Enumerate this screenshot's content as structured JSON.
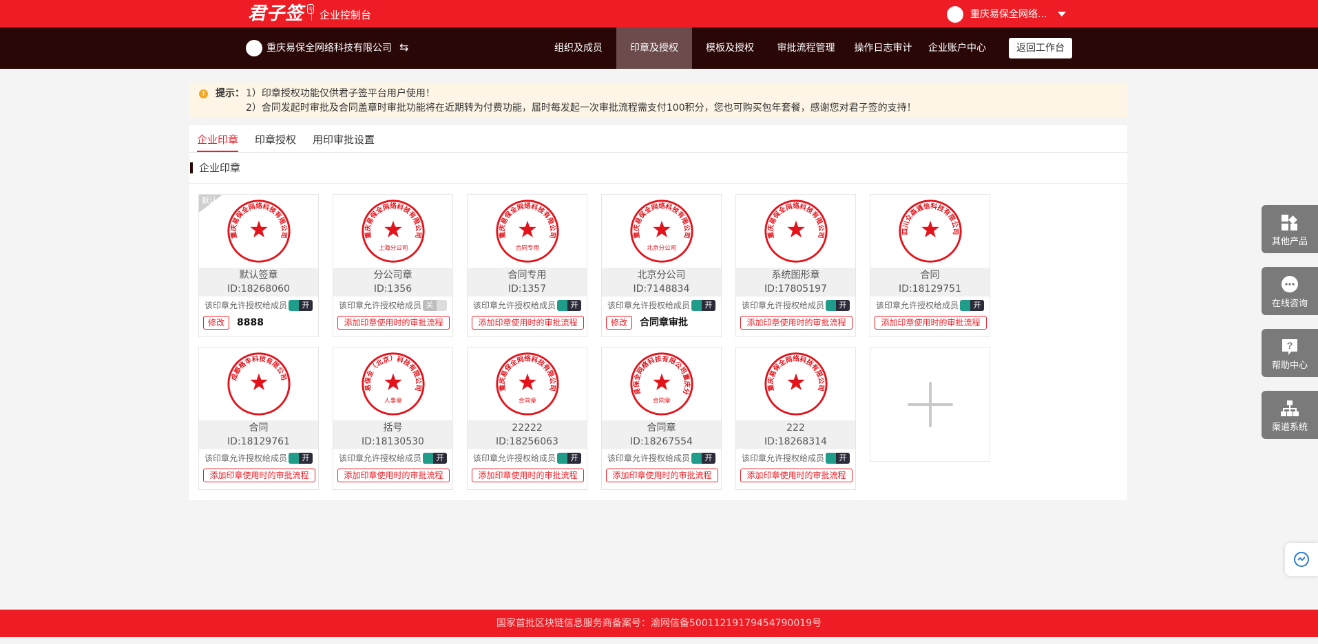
{
  "topbar": {
    "logo": "君子签",
    "logo_badge": "®",
    "console_title": "企业控制台",
    "user_name": "重庆易保全网络..."
  },
  "nav": {
    "company_name": "重庆易保全网络科技有限公司",
    "switch_icon": "⇆",
    "items": [
      {
        "label": "组织及成员",
        "active": false
      },
      {
        "label": "印章及授权",
        "active": true
      },
      {
        "label": "模板及授权",
        "active": false
      },
      {
        "label": "审批流程管理",
        "active": false
      },
      {
        "label": "操作日志审计",
        "active": false
      },
      {
        "label": "企业账户中心",
        "active": false
      }
    ],
    "back_label": "返回工作台"
  },
  "notice": {
    "icon": "!",
    "label": "提示：",
    "line1": "1）印章授权功能仅供君子签平台用户使用！",
    "line2": "2）合同发起时审批及合同盖章时审批功能将在近期转为付费功能，届时每发起一次审批流程需支付100积分，您也可购买包年套餐，感谢您对君子签的支持！"
  },
  "tabs": [
    {
      "label": "企业印章",
      "active": true
    },
    {
      "label": "印章授权",
      "active": false
    },
    {
      "label": "用印审批设置",
      "active": false
    }
  ],
  "section_title": "企业印章",
  "default_tag": "默认",
  "perm_text": "该印章允许授权给成员",
  "toggle_on": "开",
  "toggle_off": "关",
  "approval_label": "添加印章使用时的审批流程",
  "edit_label": "修改",
  "seal_color": "#e3131b",
  "seals": [
    {
      "name": "默认签章",
      "id": "ID:18268060",
      "toggle": "on",
      "default": true,
      "flow": "8888",
      "seal_text": "重庆易保全网络科技有限公司",
      "seal_bottom": ""
    },
    {
      "name": "分公司章",
      "id": "ID:1356",
      "toggle": "off",
      "default": false,
      "flow": "",
      "seal_text": "重庆易保全网络科技有限公司",
      "seal_bottom": "上海分公司"
    },
    {
      "name": "合同专用",
      "id": "ID:1357",
      "toggle": "on",
      "default": false,
      "flow": "",
      "seal_text": "重庆易保全网络科技有限公司",
      "seal_bottom": "合同专用"
    },
    {
      "name": "北京分公司",
      "id": "ID:7148834",
      "toggle": "on",
      "default": false,
      "flow": "合同章审批",
      "seal_text": "重庆易保全网络科技有限公司",
      "seal_bottom": "北京分公司"
    },
    {
      "name": "系统图形章",
      "id": "ID:17805197",
      "toggle": "on",
      "default": false,
      "flow": "",
      "seal_text": "重庆易保全网络科技有限公司",
      "seal_bottom": ""
    },
    {
      "name": "合同",
      "id": "ID:18129751",
      "toggle": "on",
      "default": false,
      "flow": "",
      "seal_text": "四川众森通信科技有限公司",
      "seal_bottom": ""
    },
    {
      "name": "合同",
      "id": "ID:18129761",
      "toggle": "on",
      "default": false,
      "flow": "",
      "seal_text": "成都格丰科技有限公司",
      "seal_bottom": ""
    },
    {
      "name": "括号",
      "id": "ID:18130530",
      "toggle": "on",
      "default": false,
      "flow": "",
      "seal_text": "易保全（北京）科技有限公司",
      "seal_bottom": "人事章"
    },
    {
      "name": "22222",
      "id": "ID:18256063",
      "toggle": "on",
      "default": false,
      "flow": "",
      "seal_text": "重庆易保全网络科技有限公司",
      "seal_bottom": "合同章"
    },
    {
      "name": "合同章",
      "id": "ID:18267554",
      "toggle": "on",
      "default": false,
      "flow": "",
      "seal_text": "成都易保全网络科技有限公司重庆分公司",
      "seal_bottom": "合同章"
    },
    {
      "name": "222",
      "id": "ID:18268314",
      "toggle": "on",
      "default": false,
      "flow": "",
      "seal_text": "重庆易保全网络科技有限公司",
      "seal_bottom": ""
    }
  ],
  "float_buttons": [
    {
      "label": "其他产品",
      "icon": "grid-icon"
    },
    {
      "label": "在线咨询",
      "icon": "chat-icon"
    },
    {
      "label": "帮助中心",
      "icon": "help-icon"
    },
    {
      "label": "渠道系统",
      "icon": "org-chart-icon"
    }
  ],
  "footer": "国家首批区块链信息服务商备案号：渝网信备50011219179454790019号"
}
